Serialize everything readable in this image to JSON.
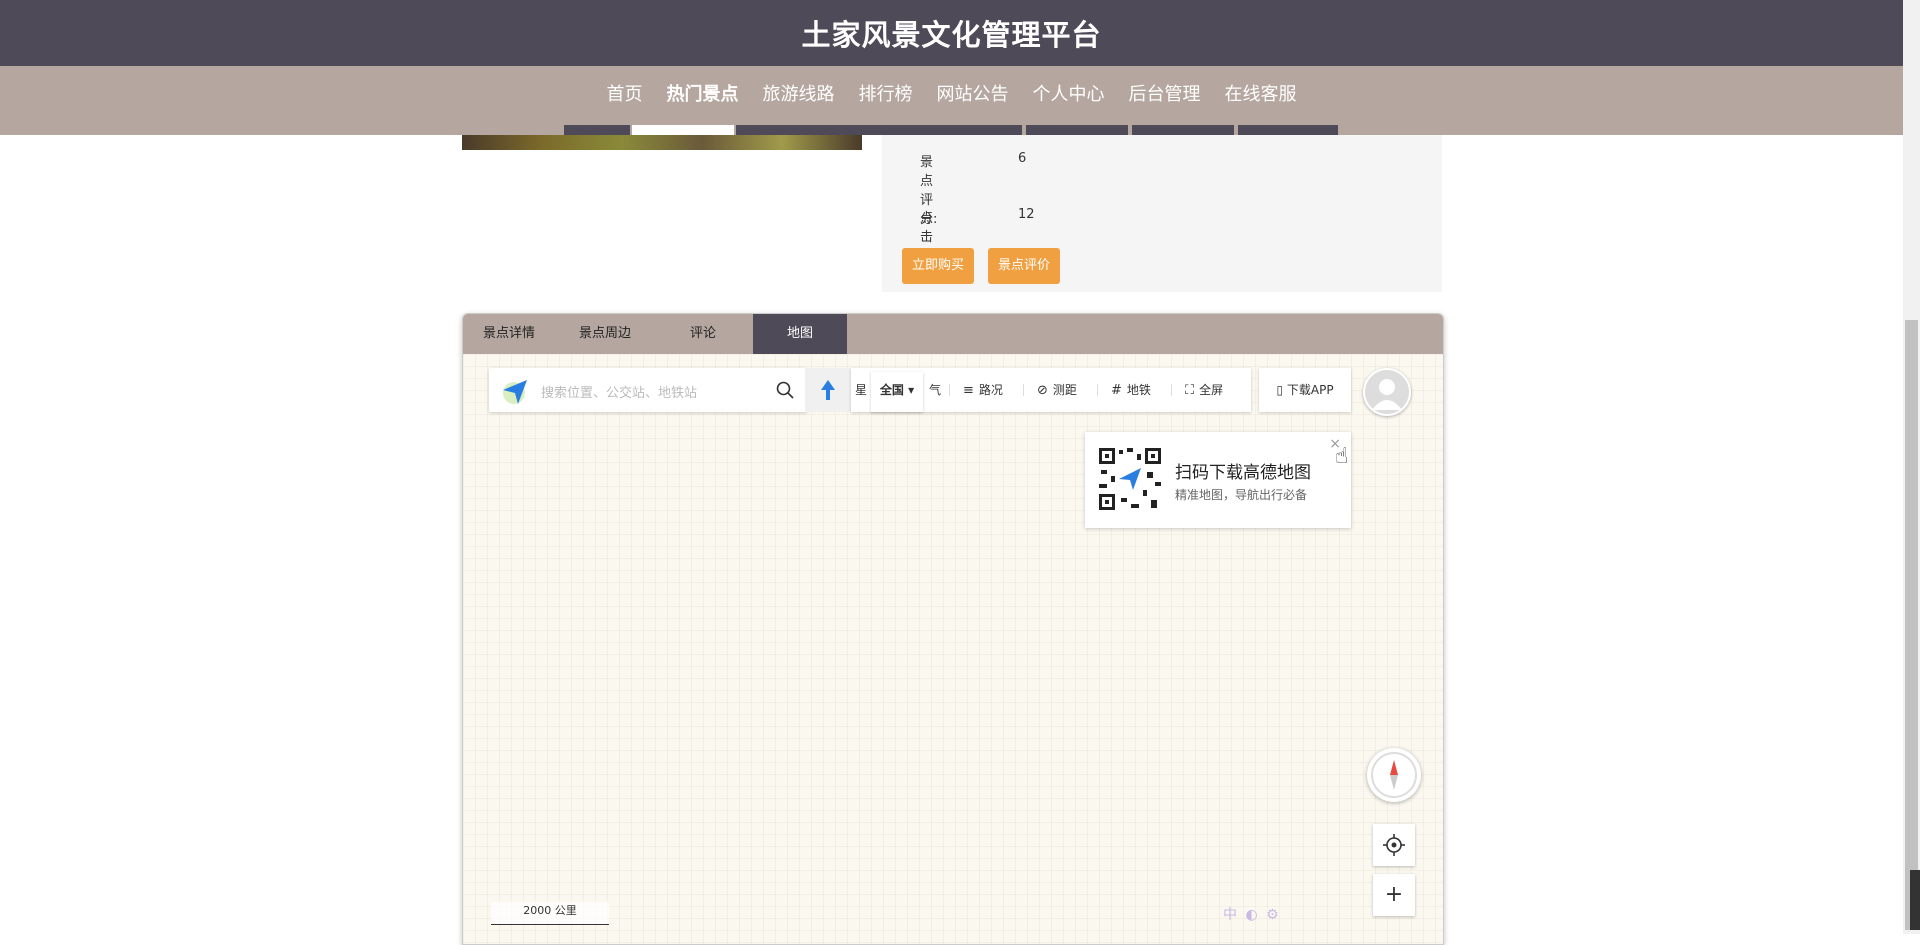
{
  "header": {
    "title": "土家风景文化管理平台"
  },
  "nav": {
    "items": [
      {
        "label": "首页",
        "active": false
      },
      {
        "label": "热门景点",
        "active": true
      },
      {
        "label": "旅游线路",
        "active": false
      },
      {
        "label": "排行榜",
        "active": false
      },
      {
        "label": "网站公告",
        "active": false
      },
      {
        "label": "个人中心",
        "active": false
      },
      {
        "label": "后台管理",
        "active": false
      },
      {
        "label": "在线客服",
        "active": false
      }
    ]
  },
  "info": {
    "rating_label": "景点评分:",
    "rating_value": "6",
    "clicks_label": "点击次数:",
    "clicks_value": "12",
    "buy_label": "立即购买",
    "review_label": "景点评价"
  },
  "tabs": [
    {
      "label": "景点详情",
      "active": false
    },
    {
      "label": "景点周边",
      "active": false
    },
    {
      "label": "评论",
      "active": false
    },
    {
      "label": "地图",
      "active": true
    }
  ],
  "map": {
    "search_placeholder": "搜索位置、公交站、地铁站",
    "region_label": "全国",
    "tools": {
      "satellite": "星",
      "weather": "气",
      "traffic": "路况",
      "measure": "测距",
      "subway": "地铁",
      "fullscreen": "全屏"
    },
    "download_app": "下载APP",
    "qr_title": "扫码下载高德地图",
    "qr_subtitle": "精准地图，导航出行必备",
    "qr_close": "×",
    "scale_label": "2000 公里",
    "watermark": "中",
    "zoom_in": "+"
  },
  "colors": {
    "header_bg": "#4f4a57",
    "nav_bg": "#b5a69f",
    "accent_button": "#f0a040",
    "active_tab": "#4f4a57"
  }
}
